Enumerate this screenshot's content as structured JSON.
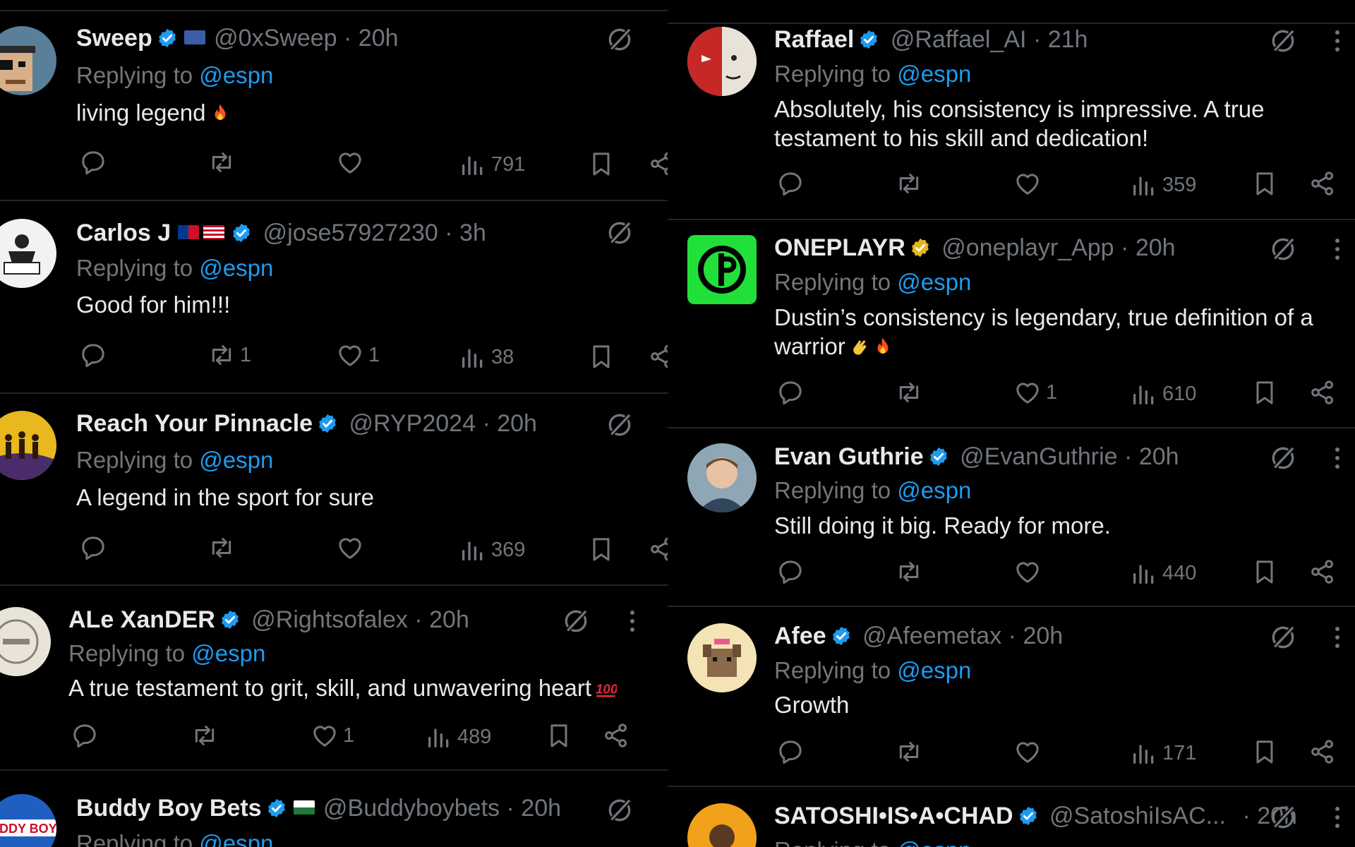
{
  "left": {
    "tweets": [
      {
        "name": "Sweep",
        "handle": "@0xSweep",
        "dot": "·",
        "time": "20h",
        "replying": "Replying to",
        "mention": "@espn",
        "text": "living legend",
        "emoji": "fire-emoji",
        "views": "791",
        "likes": "",
        "retweets": "",
        "avatar": "pixel-pirate-avatar"
      },
      {
        "name": "Carlos J",
        "handle": "@jose57927230",
        "dot": "·",
        "time": "3h",
        "replying": "Replying to",
        "mention": "@espn",
        "text": "Good for him!!!",
        "emoji": "",
        "views": "38",
        "likes": "1",
        "retweets": "1",
        "avatar": "figure-avatar"
      },
      {
        "name": "Reach Your Pinnacle",
        "handle": "@RYP2024",
        "dot": "·",
        "time": "20h",
        "replying": "Replying to",
        "mention": "@espn",
        "text": "A legend in the sport for sure",
        "emoji": "",
        "views": "369",
        "likes": "",
        "retweets": "",
        "avatar": "pinnacle-avatar"
      },
      {
        "name": "ALe XanDER",
        "handle": "@Rightsofalex",
        "dot": "·",
        "time": "20h",
        "replying": "Replying to",
        "mention": "@espn",
        "text": "A true testament to grit, skill, and unwavering heart",
        "emoji": "hundred-emoji",
        "views": "489",
        "likes": "1",
        "retweets": "",
        "avatar": "rightsofalex-avatar"
      },
      {
        "name": "Buddy Boy Bets",
        "handle": "@Buddyboybets",
        "dot": "·",
        "time": "20h",
        "replying": "Replying to",
        "mention": "@espn",
        "text": "",
        "emoji": "",
        "views": "",
        "likes": "",
        "retweets": "",
        "avatar": "buddyboy-avatar"
      }
    ]
  },
  "right": {
    "tweets": [
      {
        "name": "Raffael",
        "handle": "@Raffael_AI",
        "dot": "·",
        "time": "21h",
        "replying": "Replying to",
        "mention": "@espn",
        "text": "Absolutely, his consistency is impressive. A true testament to his skill and dedication!",
        "emoji": "",
        "views": "359",
        "likes": "",
        "retweets": "",
        "avatar": "spiderman-avatar"
      },
      {
        "name": "ONEPLAYR",
        "handle": "@oneplayr_App",
        "dot": "·",
        "time": "20h",
        "replying": "Replying to",
        "mention": "@espn",
        "text": "Dustin’s consistency is legendary, true definition of a warrior",
        "emoji": "clap-fire-emoji",
        "views": "610",
        "likes": "1",
        "retweets": "",
        "avatar": "oneplayr-logo"
      },
      {
        "name": "Evan Guthrie",
        "handle": "@EvanGuthrie",
        "dot": "·",
        "time": "20h",
        "replying": "Replying to",
        "mention": "@espn",
        "text": "Still doing it big. Ready for more.",
        "emoji": "",
        "views": "440",
        "likes": "",
        "retweets": "",
        "avatar": "photo-avatar"
      },
      {
        "name": "Afee",
        "handle": "@Afeemetax",
        "dot": "·",
        "time": "20h",
        "replying": "Replying to",
        "mention": "@espn",
        "text": "Growth",
        "emoji": "",
        "views": "171",
        "likes": "",
        "retweets": "",
        "avatar": "dog-avatar"
      },
      {
        "name": "SATOSHI•IS•A•CHAD",
        "handle": "@SatoshiIsAC...",
        "dot": "·",
        "time": "20h",
        "replying": "Replying to",
        "mention": "@espn",
        "text": "",
        "emoji": "",
        "views": "",
        "likes": "",
        "retweets": "",
        "avatar": "satoshi-avatar"
      }
    ]
  },
  "colors": {
    "background": "#000000",
    "text": "#e7e9ea",
    "muted": "#71767b",
    "link": "#1d9bf0",
    "verified": "#1d9bf0",
    "gold": "#e2b719",
    "divider": "#22262a"
  }
}
